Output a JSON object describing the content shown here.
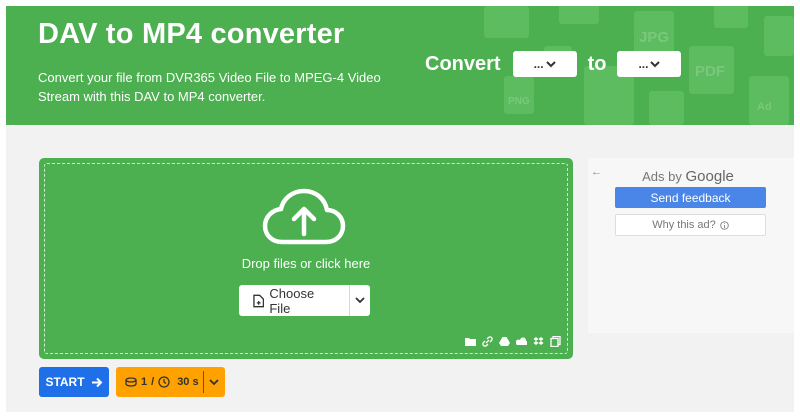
{
  "header": {
    "title": "DAV to MP4 converter",
    "description": "Convert your file from DVR365 Video File to MPEG-4 Video Stream with this DAV to MP4 converter.",
    "convert_label": "Convert",
    "to_label": "to",
    "from_select_value": "...",
    "to_select_value": "...",
    "bg_icon_labels": [
      "JPG",
      "PDF",
      "PNG",
      "Ad"
    ]
  },
  "dropzone": {
    "drop_text": "Drop files or click here",
    "choose_file_label": "Choose File",
    "source_icons": [
      "folder-icon",
      "link-icon",
      "google-drive-icon",
      "onedrive-icon",
      "dropbox-icon",
      "copy-icon"
    ]
  },
  "actions": {
    "start_label": "START",
    "limit_files": "1",
    "limit_separator": "/",
    "limit_time": "30 s"
  },
  "ads": {
    "ads_by_label": "Ads by",
    "google_label": "Google",
    "send_feedback_label": "Send feedback",
    "why_ad_label": "Why this ad?"
  },
  "colors": {
    "header_green": "#4caf50",
    "start_blue": "#1e6fe8",
    "limit_orange": "#ffa200",
    "feedback_blue": "#4a86e8"
  }
}
